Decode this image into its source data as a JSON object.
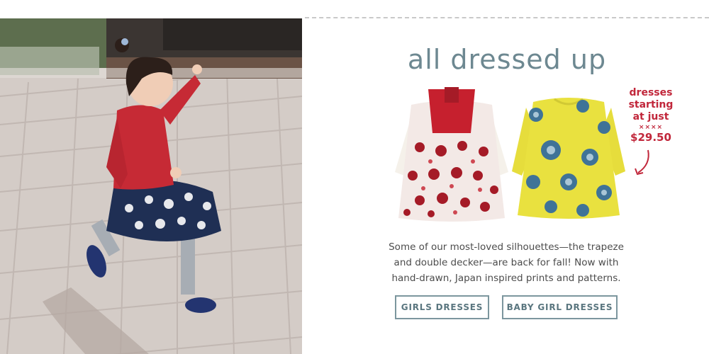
{
  "headline": "all dressed up",
  "promo": {
    "line1": "dresses",
    "line2": "starting",
    "line3": "at just",
    "stars": "××××",
    "price": "$29.50"
  },
  "description": {
    "line1": "Some of our most-loved silhouettes—the trapeze",
    "line2": "and double decker—are back for fall! Now with",
    "line3": "hand-drawn, Japan inspired prints and patterns."
  },
  "buttons": {
    "girls_label": "GIRLS DRESSES",
    "baby_label": "BABY GIRL DRESSES"
  },
  "colors": {
    "accent_teal": "#6d8891",
    "promo_red": "#c1273b",
    "button_border": "#7c969e"
  },
  "icons": {
    "promo_arrow": "curved-arrow-down-left-icon"
  }
}
